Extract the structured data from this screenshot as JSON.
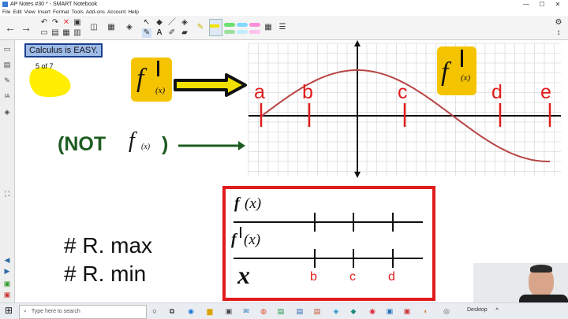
{
  "window": {
    "title": "AP Notes #30 * - SMART Notebook",
    "min": "—",
    "max": "☐",
    "close": "✕"
  },
  "menu": [
    "File",
    "Edit",
    "View",
    "Insert",
    "Format",
    "Tools",
    "Add-ons",
    "Account",
    "Help"
  ],
  "slide": {
    "title": "Calculus is EASY.",
    "page": "5 of 7",
    "label_f": "f",
    "label_x": "(x)",
    "not_open": "(NOT",
    "not_close": ")",
    "r_max": "# R. max",
    "r_min": "# R. min",
    "graph_points": [
      "a",
      "b",
      "c",
      "d",
      "e"
    ],
    "chart_row1": "f",
    "chart_row1_arg": "(x)",
    "chart_row2": "f",
    "chart_row2_arg": "(x)",
    "chart_row3": "x",
    "chart_ticks": [
      "b",
      "c",
      "d"
    ]
  },
  "taskbar": {
    "search_placeholder": "Type here to search",
    "desktop": "Desktop"
  },
  "colors": {
    "accent_yellow": "#f5c400",
    "graph_red": "#b84545",
    "marker_red": "#e11b1b",
    "dark_green": "#1d5c20",
    "box_red": "#e11b1b"
  }
}
